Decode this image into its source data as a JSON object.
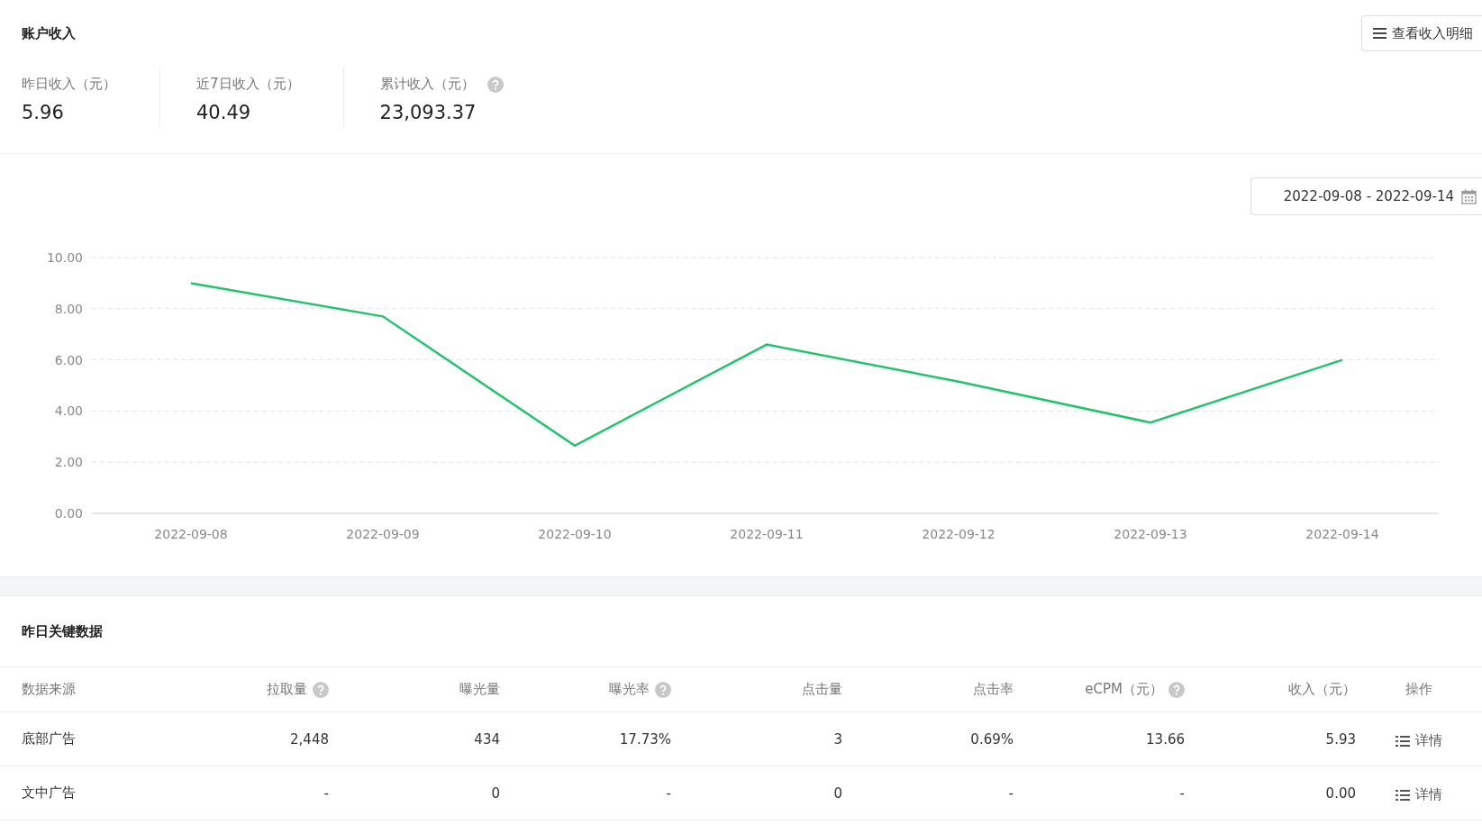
{
  "income": {
    "title": "账户收入",
    "detail_button": "查看收入明细",
    "stats": [
      {
        "label": "昨日收入（元）",
        "value": "5.96",
        "help": false
      },
      {
        "label": "近7日收入（元）",
        "value": "40.49",
        "help": false
      },
      {
        "label": "累计收入（元）",
        "value": "23,093.37",
        "help": true
      }
    ]
  },
  "date_range": "2022-09-08 - 2022-09-14",
  "chart_data": {
    "type": "line",
    "categories": [
      "2022-09-08",
      "2022-09-09",
      "2022-09-10",
      "2022-09-11",
      "2022-09-12",
      "2022-09-13",
      "2022-09-14"
    ],
    "grid": true,
    "series": [
      {
        "color": "#21c46a",
        "values": [
          9.0,
          7.7,
          2.65,
          6.6,
          5.15,
          3.55,
          6.0
        ]
      }
    ],
    "ylim": [
      0,
      10
    ],
    "yticks": [
      {
        "value": 0,
        "label": "0.00"
      },
      {
        "value": 2,
        "label": "2.00"
      },
      {
        "value": 4,
        "label": "4.00"
      },
      {
        "value": 6,
        "label": "6.00"
      },
      {
        "value": 8,
        "label": "8.00"
      },
      {
        "value": 10,
        "label": "10.00"
      }
    ]
  },
  "key_data": {
    "title": "昨日关键数据",
    "columns": [
      {
        "label": "数据来源",
        "help": false
      },
      {
        "label": "拉取量",
        "help": true
      },
      {
        "label": "曝光量",
        "help": false
      },
      {
        "label": "曝光率",
        "help": true
      },
      {
        "label": "点击量",
        "help": false
      },
      {
        "label": "点击率",
        "help": false
      },
      {
        "label": "eCPM（元）",
        "help": true
      },
      {
        "label": "收入（元）",
        "help": false
      },
      {
        "label": "操作",
        "help": false
      }
    ],
    "rows": [
      {
        "cells": [
          "底部广告",
          "2,448",
          "434",
          "17.73%",
          "3",
          "0.69%",
          "13.66",
          "5.93"
        ],
        "action": "详情"
      },
      {
        "cells": [
          "文中广告",
          "-",
          "0",
          "-",
          "0",
          "-",
          "-",
          "0.00"
        ],
        "action": "详情"
      }
    ]
  }
}
